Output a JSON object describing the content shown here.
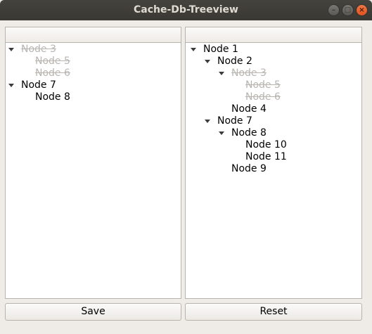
{
  "window": {
    "title": "Cache-Db-Treeview"
  },
  "cache_tree": {
    "rows": [
      {
        "label": "Node 3",
        "level": 0,
        "expandable": true,
        "deleted": true
      },
      {
        "label": "Node 5",
        "level": 1,
        "expandable": false,
        "deleted": true
      },
      {
        "label": "Node 6",
        "level": 1,
        "expandable": false,
        "deleted": true
      },
      {
        "label": "Node 7",
        "level": 0,
        "expandable": true,
        "deleted": false
      },
      {
        "label": "Node 8",
        "level": 1,
        "expandable": false,
        "deleted": false
      }
    ]
  },
  "db_tree": {
    "rows": [
      {
        "label": "Node 1",
        "level": 0,
        "expandable": true,
        "deleted": false
      },
      {
        "label": "Node 2",
        "level": 1,
        "expandable": true,
        "deleted": false
      },
      {
        "label": "Node 3",
        "level": 2,
        "expandable": true,
        "deleted": true
      },
      {
        "label": "Node 5",
        "level": 3,
        "expandable": false,
        "deleted": true
      },
      {
        "label": "Node 6",
        "level": 3,
        "expandable": false,
        "deleted": true
      },
      {
        "label": "Node 4",
        "level": 2,
        "expandable": false,
        "deleted": false
      },
      {
        "label": "Node 7",
        "level": 1,
        "expandable": true,
        "deleted": false
      },
      {
        "label": "Node 8",
        "level": 2,
        "expandable": true,
        "deleted": false
      },
      {
        "label": "Node 10",
        "level": 3,
        "expandable": false,
        "deleted": false
      },
      {
        "label": "Node 11",
        "level": 3,
        "expandable": false,
        "deleted": false
      },
      {
        "label": "Node 9",
        "level": 2,
        "expandable": false,
        "deleted": false
      }
    ]
  },
  "buttons": {
    "save": "Save",
    "reset": "Reset"
  },
  "window_controls": {
    "minimize": "–",
    "maximize": "□",
    "close": "×"
  }
}
